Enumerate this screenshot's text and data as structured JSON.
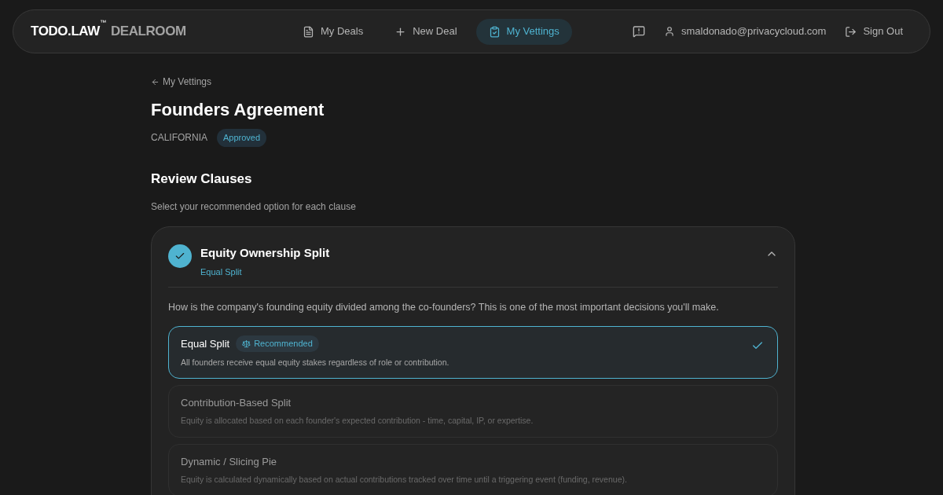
{
  "brand": {
    "name": "TODO.LAW",
    "mark": "™",
    "product": "DEALROOM"
  },
  "nav": [
    {
      "label": "My Deals",
      "kind": "document",
      "selected": false
    },
    {
      "label": "New Deal",
      "kind": "plus",
      "selected": false
    },
    {
      "label": "My Vettings",
      "kind": "clipboard",
      "selected": true
    }
  ],
  "user": {
    "email": "smaldonado@privacycloud.com",
    "sign_out": "Sign Out"
  },
  "back_link": "My Vettings",
  "title": "Founders Agreement",
  "jurisdiction": "CALIFORNIA",
  "status": "Approved",
  "section": {
    "title": "Review Clauses",
    "subtitle": "Select your recommended option for each clause"
  },
  "clause": {
    "title": "Equity Ownership Split",
    "answer": "Equal Split",
    "done": true,
    "expanded": true,
    "question": "How is the company's founding equity divided among the co-founders? This is one of the most important decisions you'll make.",
    "options": [
      {
        "title": "Equal Split",
        "badge": "Recommended",
        "description": "All founders receive equal equity stakes regardless of role or contribution.",
        "selected": true
      },
      {
        "title": "Contribution-Based Split",
        "description": "Equity is allocated based on each founder's expected contribution - time, capital, IP, or expertise.",
        "selected": false
      },
      {
        "title": "Dynamic / Slicing Pie",
        "description": "Equity is calculated dynamically based on actual contributions tracked over time until a triggering event (funding, revenue).",
        "selected": false
      }
    ]
  }
}
